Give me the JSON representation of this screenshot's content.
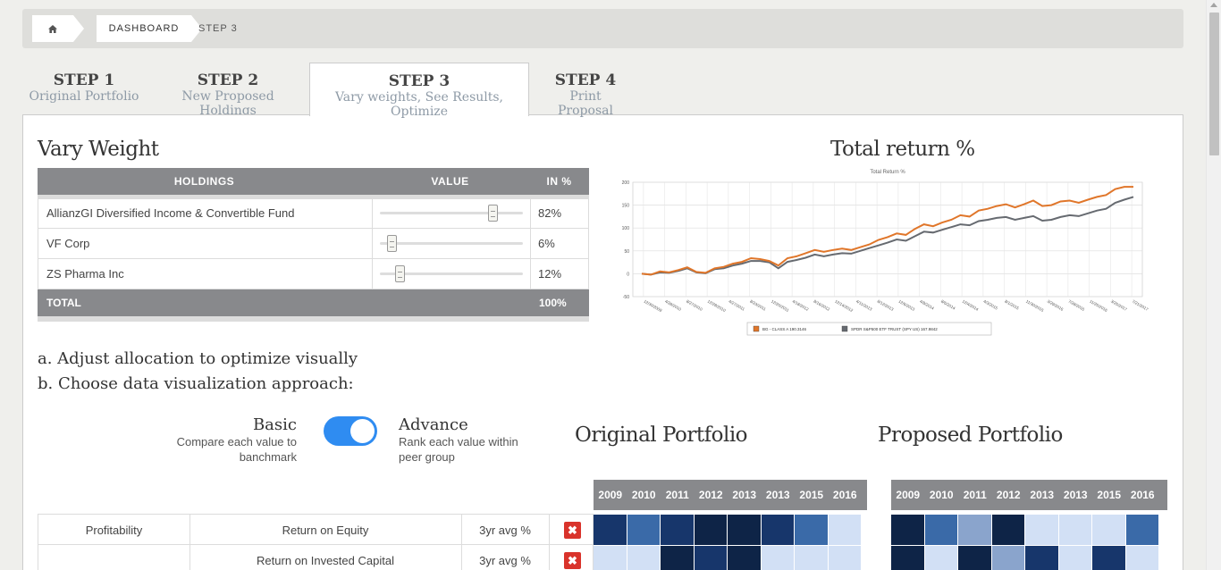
{
  "breadcrumb": {
    "home_icon": "home-icon",
    "dashboard": "DASHBOARD",
    "current": "STEP 3"
  },
  "tabs": [
    {
      "title": "STEP 1",
      "subtitle": "Original Portfolio"
    },
    {
      "title": "STEP 2",
      "subtitle": "New Proposed Holdings"
    },
    {
      "title": "STEP 3",
      "subtitle": "Vary weights, See Results, Optimize"
    },
    {
      "title": "STEP 4",
      "subtitle": "Print Proposal"
    }
  ],
  "vary_weight": {
    "title": "Vary Weight",
    "headers": {
      "holdings": "HOLDINGS",
      "value": "VALUE",
      "in_pct": "IN %"
    },
    "rows": [
      {
        "name": "AllianzGI Diversified Income & Convertible Fund",
        "pct": "82%",
        "slider": 0.82
      },
      {
        "name": "VF Corp",
        "pct": "6%",
        "slider": 0.06
      },
      {
        "name": "ZS Pharma Inc",
        "pct": "12%",
        "slider": 0.12
      }
    ],
    "total_label": "TOTAL",
    "total_value": "100%"
  },
  "total_return": {
    "title": "Total return %"
  },
  "chart_data": {
    "type": "line",
    "title": "Total Return %",
    "ylim": [
      -50,
      200
    ],
    "yticks": [
      "200",
      "150",
      "100",
      "50",
      "0",
      "-50"
    ],
    "xticks": [
      "12/30/2009",
      "4/28/2010",
      "8/27/2010",
      "12/28/2010",
      "4/27/2011",
      "8/23/2011",
      "12/20/2011",
      "4/18/2012",
      "8/16/2012",
      "12/14/2012",
      "4/11/2013",
      "8/12/2013",
      "12/6/2013",
      "4/8/2014",
      "8/6/2014",
      "12/4/2014",
      "4/3/2015",
      "8/1/2015",
      "11/30/2015",
      "3/29/2016",
      "7/28/2016",
      "11/25/2016",
      "3/25/2017",
      "7/21/2017"
    ],
    "legend": [
      "BG - CLASS A 190.3146",
      "SPDR S&P500 ETF TRUST (SPY US) 167.9842"
    ],
    "colors": [
      "#e0762a",
      "#666a70"
    ],
    "series": [
      {
        "name": "BG - CLASS A 190.3146",
        "values": [
          0,
          -2,
          5,
          3,
          8,
          14,
          4,
          2,
          12,
          15,
          22,
          26,
          34,
          32,
          28,
          18,
          34,
          38,
          45,
          52,
          48,
          52,
          55,
          52,
          58,
          64,
          74,
          80,
          88,
          85,
          98,
          108,
          104,
          112,
          118,
          128,
          125,
          138,
          142,
          148,
          152,
          145,
          152,
          160,
          148,
          150,
          158,
          160,
          155,
          162,
          168,
          172,
          185,
          190,
          190
        ]
      },
      {
        "name": "SPDR S&P500 ETF TRUST (SPY US) 167.9842",
        "values": [
          0,
          -2,
          3,
          2,
          6,
          12,
          3,
          1,
          10,
          12,
          18,
          22,
          28,
          28,
          25,
          12,
          26,
          30,
          35,
          42,
          38,
          42,
          45,
          44,
          50,
          56,
          62,
          68,
          75,
          72,
          82,
          92,
          90,
          96,
          102,
          108,
          106,
          115,
          118,
          122,
          124,
          118,
          122,
          126,
          116,
          118,
          124,
          128,
          126,
          132,
          138,
          142,
          155,
          162,
          168
        ]
      }
    ]
  },
  "instructions": {
    "a": "a. Adjust allocation to optimize visually",
    "b": "b. Choose data visualization approach:"
  },
  "toggle": {
    "basic_title": "Basic",
    "basic_sub": "Compare each value to banchmark",
    "advance_title": "Advance",
    "advance_sub": "Rank each value within peer group",
    "state": "advance"
  },
  "original_portfolio": {
    "title": "Original Portfolio"
  },
  "proposed_portfolio": {
    "title": "Proposed Portfolio"
  },
  "years": [
    "2009",
    "2010",
    "2011",
    "2012",
    "2013",
    "2013",
    "2015",
    "2016"
  ],
  "metrics": [
    {
      "group": "Profitability",
      "name": "Return on Equity",
      "measure": "3yr avg %",
      "remove_icon": "close-icon"
    },
    {
      "group": "",
      "name": "Return on Invested Capital",
      "measure": "3yr avg %",
      "remove_icon": "close-icon"
    }
  ],
  "heatmap_colors": {
    "original": [
      [
        "#17366b",
        "#3a6aa8",
        "#17366b",
        "#0e2447",
        "#0e2447",
        "#17366b",
        "#3a6aa8",
        "#d2e0f5"
      ],
      [
        "#d2e0f5",
        "#d2e0f5",
        "#0e2447",
        "#17366b",
        "#0e2447",
        "#d2e0f5",
        "#d2e0f5",
        "#d2e0f5"
      ]
    ],
    "proposed": [
      [
        "#0e2447",
        "#3a6aa8",
        "#8aa4cc",
        "#0e2447",
        "#d2e0f5",
        "#d2e0f5",
        "#d2e0f5",
        "#3a6aa8"
      ],
      [
        "#0e2447",
        "#d2e0f5",
        "#0e2447",
        "#8aa4cc",
        "#17366b",
        "#d2e0f5",
        "#17366b",
        "#d2e0f5"
      ]
    ]
  }
}
